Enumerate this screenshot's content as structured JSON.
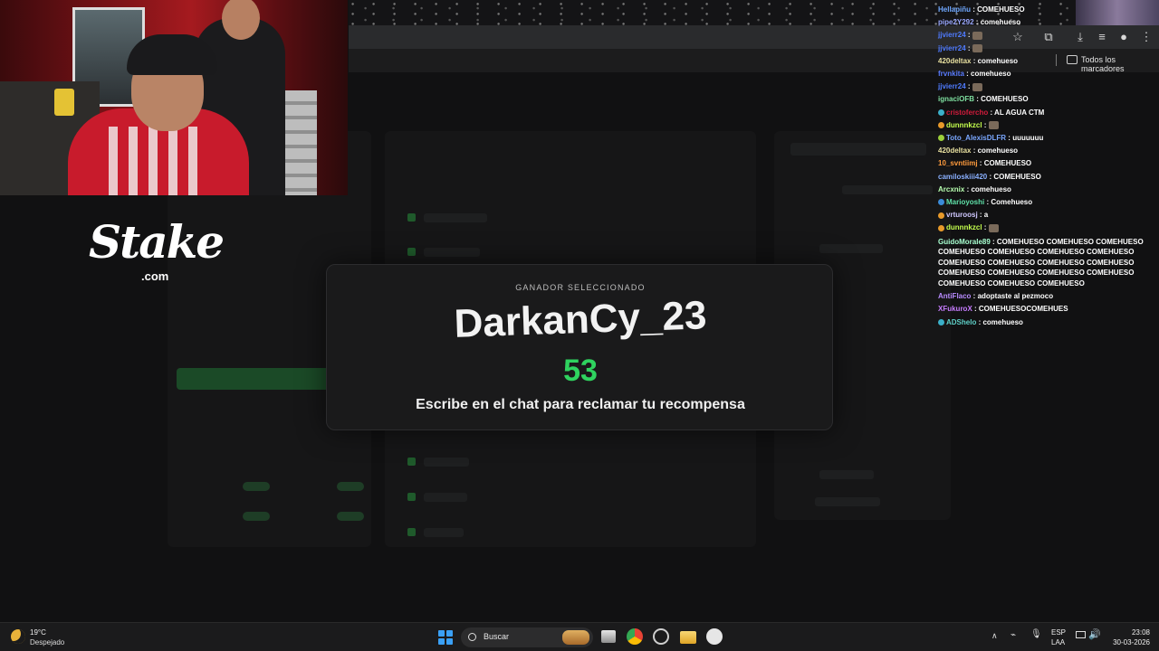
{
  "browser": {
    "bookmarks_label": "Todos los marcadores"
  },
  "overlay": {
    "brand_name": "Stake",
    "brand_domain": ".com"
  },
  "modal": {
    "label": "GANADOR SELECCIONADO",
    "winner": "DarkanCy_23",
    "number": "53",
    "instruction": "Escribe en el chat para reclamar tu recompensa"
  },
  "chat": {
    "messages": [
      {
        "user": "Hellapiñu",
        "text": "COMEHUESO",
        "color": "#6fa8ff"
      },
      {
        "user": "pipe2Y292",
        "text": "comehueso",
        "color": "#9aa8ff"
      },
      {
        "user": "jjvierr24",
        "text": "",
        "color": "#4f7bff",
        "emote": true
      },
      {
        "user": "jjvierr24",
        "text": "",
        "color": "#4f7bff",
        "emote": true
      },
      {
        "user": "420deltax",
        "text": "comehueso",
        "color": "#e8e0a0"
      },
      {
        "user": "frvnkita",
        "text": "comehueso",
        "color": "#5a7cff"
      },
      {
        "user": "jjvierr24",
        "text": "",
        "color": "#4f7bff",
        "emote": true
      },
      {
        "user": "ignaciOFB",
        "text": "COMEHUESO",
        "color": "#7fe0a0"
      },
      {
        "user": "cristofercho",
        "text": "AL AGUA CTM",
        "color": "#d01b3b",
        "badge": "#3bb0c9"
      },
      {
        "user": "dunnnkzcl",
        "text": "",
        "color": "#c4ff4d",
        "badge": "#e89a2a",
        "emote": true
      },
      {
        "user": "Toto_AlexisDLFR",
        "text": "uuuuuuu",
        "color": "#7aa7ff",
        "badge": "#9bcf3a"
      },
      {
        "user": "420deltax",
        "text": "comehueso",
        "color": "#e8e0a0"
      },
      {
        "user": "10_svntiimj",
        "text": "COMEHUESO",
        "color": "#ff9b3d"
      },
      {
        "user": "camiloskiii420",
        "text": "COMEHUESO",
        "color": "#8ab0ff"
      },
      {
        "user": "Arcxnix",
        "text": "comehueso",
        "color": "#b8ffb0"
      },
      {
        "user": "Marioyoshi",
        "text": "Comehueso",
        "color": "#5fe0a8",
        "badge": "#3b8bd8"
      },
      {
        "user": "vrturoosj",
        "text": "a",
        "color": "#d0c8ff",
        "badge": "#e89a2a"
      },
      {
        "user": "dunnnkzcl",
        "text": "",
        "color": "#c4ff4d",
        "badge": "#e89a2a",
        "emote": true
      },
      {
        "user": "GuidoMorale89",
        "text": "COMEHUESO COMEHUESO COMEHUESO COMEHUESO COMEHUESO COMEHUESO COMEHUESO COMEHUESO COMEHUESO COMEHUESO COMEHUESO COMEHUESO COMEHUESO COMEHUESO COMEHUESO COMEHUESO COMEHUESO COMEHUESO",
        "color": "#a8ffd0",
        "wrap": true
      },
      {
        "user": "AntiFlaco",
        "text": "adoptaste al pezmoco",
        "color": "#b88cff"
      },
      {
        "user": "XFukuroX",
        "text": "COMEHUESOCOMEHUES",
        "color": "#c77dff"
      },
      {
        "user": "ADShelo",
        "text": "comehueso",
        "color": "#5fd0c8",
        "badge": "#3bb0c9"
      }
    ]
  },
  "taskbar": {
    "weather_temp": "19°C",
    "weather_desc": "Despejado",
    "search_label": "Buscar",
    "lang_1": "ESP",
    "lang_2": "LAA",
    "time": "23:08",
    "date": "30-03-2026"
  }
}
